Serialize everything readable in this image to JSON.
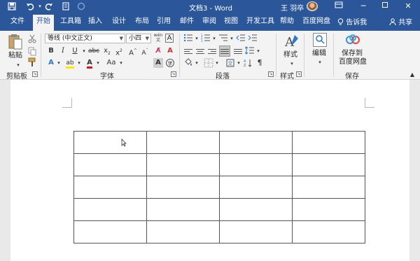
{
  "app": {
    "doc_title": "文档3 - Word",
    "user_name": "王 羽卒"
  },
  "titlebar": {
    "icons": [
      "save-icon",
      "undo-icon",
      "redo-icon",
      "touch-mode-icon",
      "circle-icon"
    ],
    "window_buttons": [
      "ribbon-display-icon",
      "minimize-icon",
      "restore-icon",
      "close-icon"
    ]
  },
  "tabs": [
    {
      "label": "文件",
      "active": false
    },
    {
      "label": "开始",
      "active": true
    },
    {
      "label": "工具箱",
      "active": false
    },
    {
      "label": "插入",
      "active": false
    },
    {
      "label": "设计",
      "active": false
    },
    {
      "label": "布局",
      "active": false
    },
    {
      "label": "引用",
      "active": false
    },
    {
      "label": "邮件",
      "active": false
    },
    {
      "label": "审阅",
      "active": false
    },
    {
      "label": "视图",
      "active": false
    },
    {
      "label": "开发工具",
      "active": false
    },
    {
      "label": "帮助",
      "active": false
    },
    {
      "label": "百度网盘",
      "active": false
    }
  ],
  "tellme": "告诉我",
  "share": "共享",
  "ribbon": {
    "clipboard": {
      "paste_label": "粘贴",
      "group_label": "剪贴板"
    },
    "font": {
      "font_name": "等线 (中文正文)",
      "font_size": "小四",
      "wen_label": "wén\n文",
      "group_label": "字体"
    },
    "paragraph": {
      "group_label": "段落"
    },
    "styles": {
      "label": "样式",
      "group_label": "样式"
    },
    "editing": {
      "label": "编辑"
    },
    "save": {
      "label_line1": "保存到",
      "label_line2": "百度网盘",
      "group_label": "保存"
    }
  },
  "table": {
    "rows": 5,
    "cols": 4
  }
}
